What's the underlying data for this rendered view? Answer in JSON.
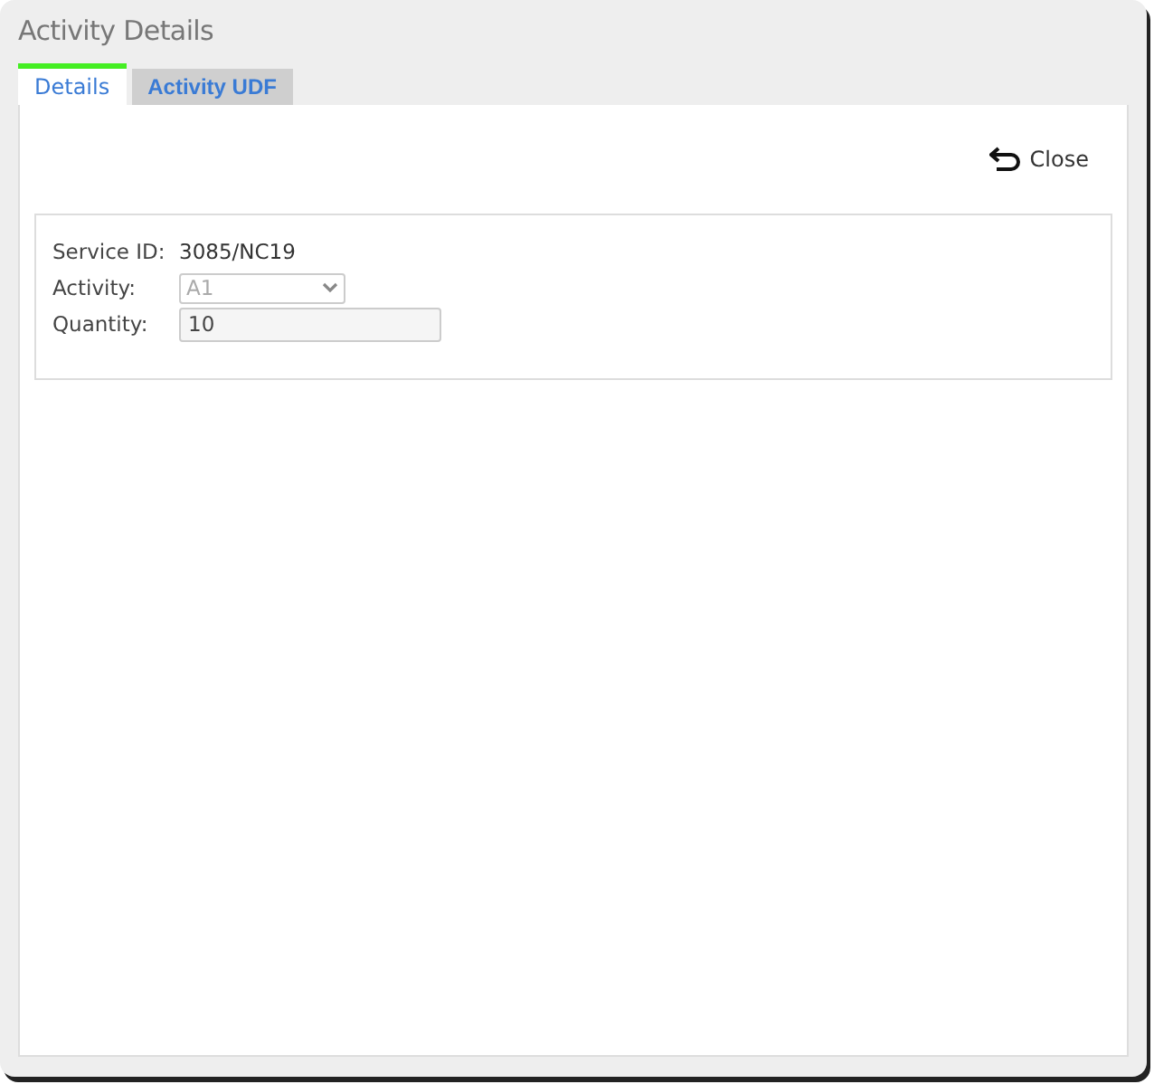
{
  "window": {
    "title": "Activity Details"
  },
  "tabs": [
    {
      "label": "Details",
      "selected": true
    },
    {
      "label": "Activity UDF",
      "selected": false
    }
  ],
  "close_button": {
    "label": "Close"
  },
  "fields": [
    {
      "kind": "text",
      "label": "Service ID:",
      "value": "3085/NC19"
    },
    {
      "kind": "select",
      "label": "Activity:",
      "value": "A1",
      "disabled": true
    },
    {
      "kind": "input",
      "label": "Quantity:",
      "value": "10",
      "disabled": false
    }
  ]
}
